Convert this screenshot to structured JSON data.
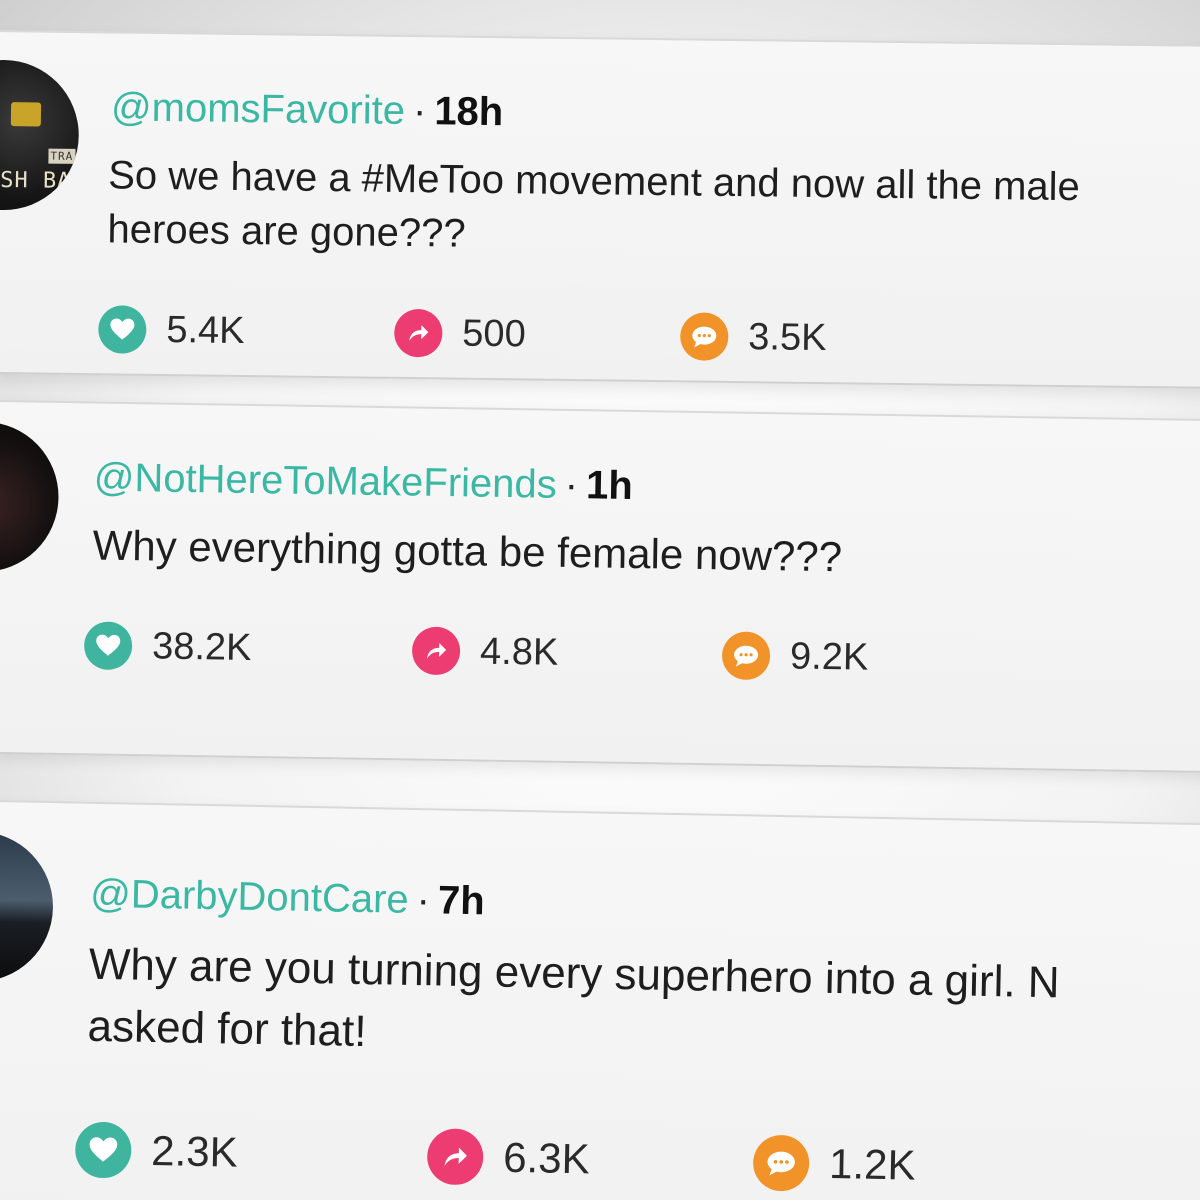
{
  "posts": [
    {
      "handle": "@momsFavorite",
      "separator": "·",
      "time": "18h",
      "lines": [
        "So we have a #MeToo movement and now all the male",
        "heroes are gone???"
      ],
      "likes": "5.4K",
      "shares": "500",
      "comments": "3.5K",
      "avatar_text": [
        "SH BA",
        "TRA"
      ]
    },
    {
      "handle": "@NotHereToMakeFriends",
      "separator": "·",
      "time": "1h",
      "lines": [
        "Why everything gotta be female now???"
      ],
      "likes": "38.2K",
      "shares": "4.8K",
      "comments": "9.2K"
    },
    {
      "handle": "@DarbyDontCare",
      "separator": "·",
      "time": "7h",
      "lines": [
        "Why are you turning every superhero into a girl. N",
        "asked for that!"
      ],
      "likes": "2.3K",
      "shares": "6.3K",
      "comments": "1.2K"
    }
  ],
  "icons": {
    "like": "heart-icon",
    "share": "share-arrow-icon",
    "comment": "comment-bubble-icon"
  },
  "colors": {
    "handle": "#3ab8a4",
    "like": "#3fb5a0",
    "share": "#ec3c72",
    "comment": "#f2932a"
  }
}
